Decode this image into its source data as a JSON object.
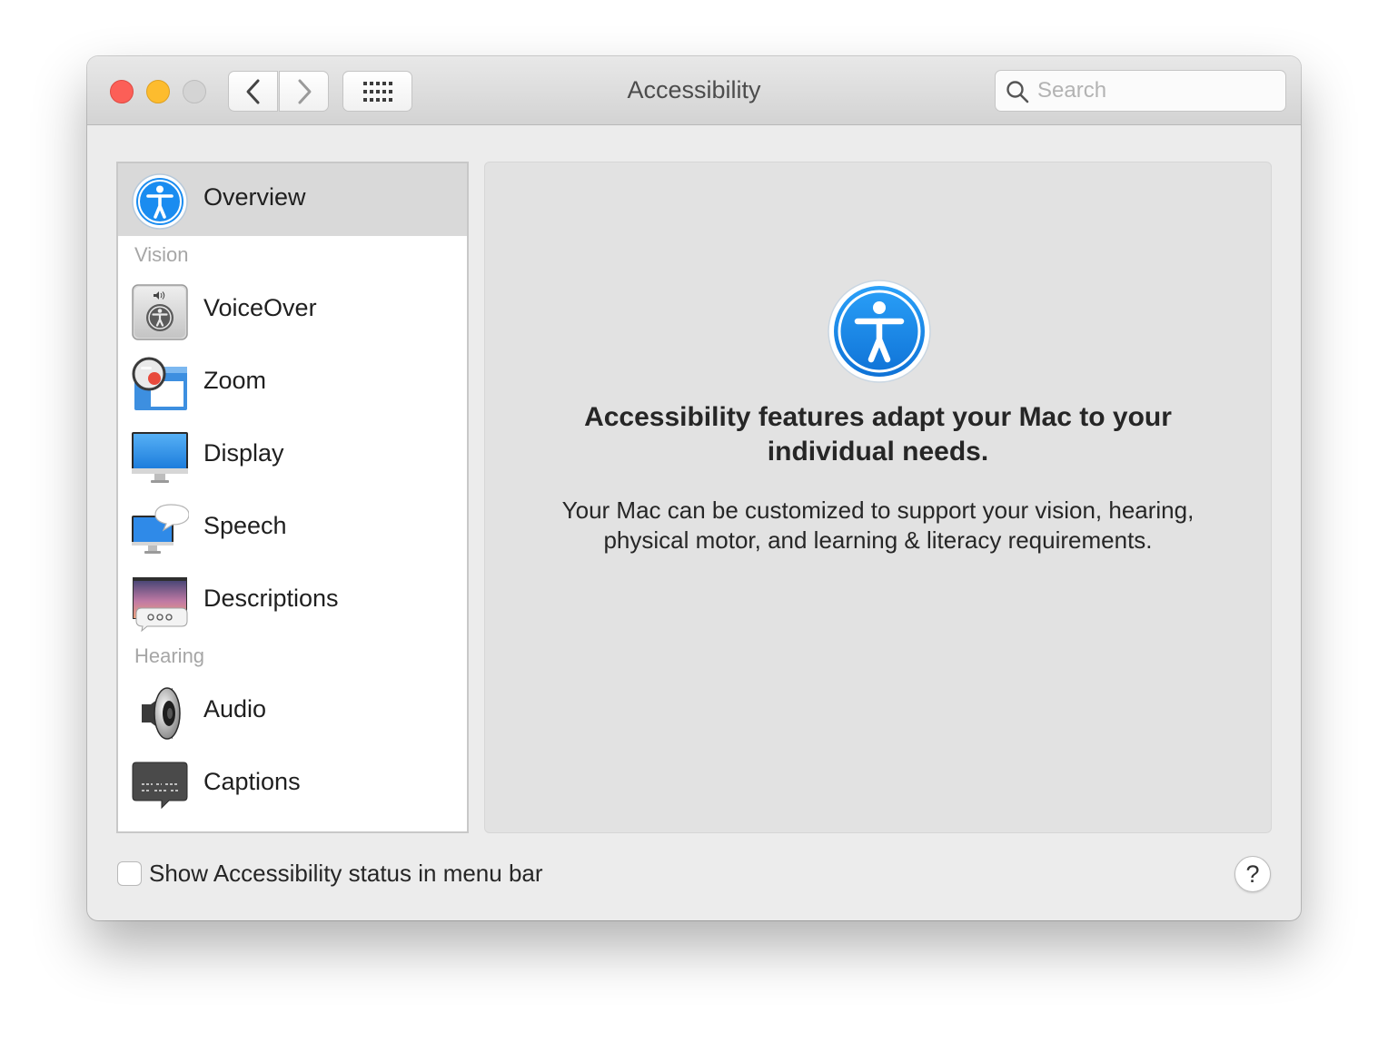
{
  "window": {
    "title": "Accessibility"
  },
  "toolbar": {
    "back_icon": "chevron-left-icon",
    "forward_icon": "chevron-right-icon",
    "grid_icon": "show-all-grid-icon"
  },
  "search": {
    "placeholder": "Search",
    "value": ""
  },
  "sidebar": {
    "overview": {
      "label": "Overview",
      "icon": "accessibility-icon"
    },
    "sections": [
      {
        "title": "Vision",
        "items": [
          {
            "label": "VoiceOver",
            "icon": "voiceover-icon"
          },
          {
            "label": "Zoom",
            "icon": "zoom-icon"
          },
          {
            "label": "Display",
            "icon": "display-icon"
          },
          {
            "label": "Speech",
            "icon": "speech-icon"
          },
          {
            "label": "Descriptions",
            "icon": "descriptions-icon"
          }
        ]
      },
      {
        "title": "Hearing",
        "items": [
          {
            "label": "Audio",
            "icon": "audio-speaker-icon"
          },
          {
            "label": "Captions",
            "icon": "captions-icon"
          }
        ]
      }
    ]
  },
  "main": {
    "headline": "Accessibility features adapt your Mac to your individual needs.",
    "body": "Your Mac can be customized to support your vision, hearing, physical motor, and learning & literacy requirements."
  },
  "footer": {
    "checkbox_label": "Show Accessibility status in menu bar",
    "checkbox_checked": false,
    "help_label": "?"
  },
  "colors": {
    "close": "#fc5f57",
    "minimize": "#fdbc2e",
    "accent_blue": "#1a8cf0",
    "selected_row": "#d9d9d9"
  }
}
